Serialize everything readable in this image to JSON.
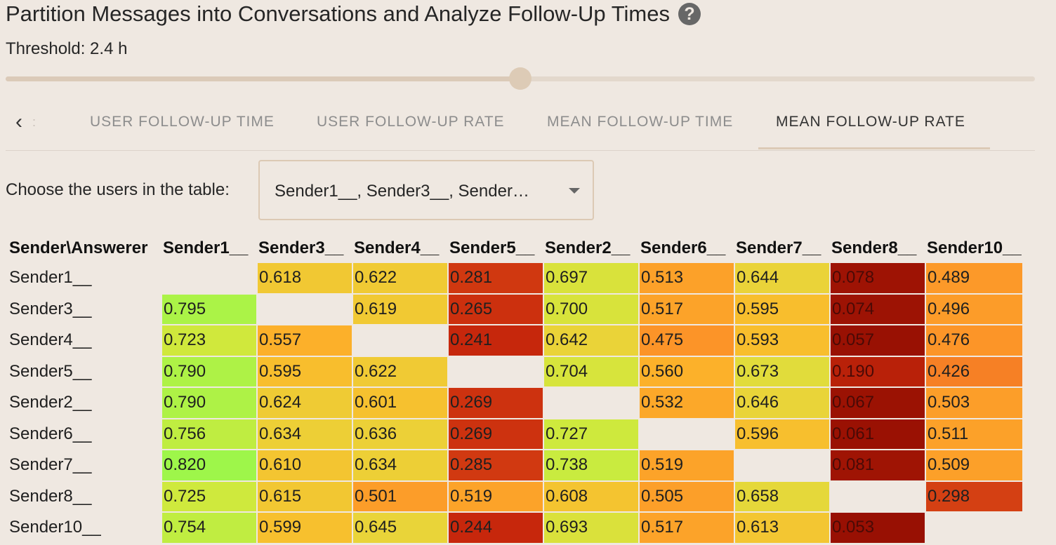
{
  "header": {
    "title": "Partition Messages into Conversations and Analyze Follow-Up Times",
    "help_icon": "?",
    "threshold_label": "Threshold: 2.4 h"
  },
  "slider": {
    "value_fraction": 0.5
  },
  "tabs": {
    "scroll_left": "‹",
    "items": [
      {
        "label": "USER FOLLOW-UP TIME",
        "active": false
      },
      {
        "label": "USER FOLLOW-UP RATE",
        "active": false
      },
      {
        "label": "MEAN FOLLOW-UP TIME",
        "active": false
      },
      {
        "label": "MEAN FOLLOW-UP RATE",
        "active": true
      }
    ]
  },
  "filter": {
    "label": "Choose the users in the table:",
    "selected_display": "Sender1__, Sender3__, Sender…"
  },
  "table": {
    "corner_header": "Sender\\Answerer",
    "columns": [
      "Sender1__",
      "Sender3__",
      "Sender4__",
      "Sender5__",
      "Sender2__",
      "Sender6__",
      "Sender7__",
      "Sender8__",
      "Sender10__"
    ],
    "rows": [
      {
        "label": "Sender1__",
        "values": [
          "",
          "0.618",
          "0.622",
          "0.281",
          "0.697",
          "0.513",
          "0.644",
          "0.078",
          "0.489"
        ]
      },
      {
        "label": "Sender3__",
        "values": [
          "0.795",
          "",
          "0.619",
          "0.265",
          "0.700",
          "0.517",
          "0.595",
          "0.074",
          "0.496"
        ]
      },
      {
        "label": "Sender4__",
        "values": [
          "0.723",
          "0.557",
          "",
          "0.241",
          "0.642",
          "0.475",
          "0.593",
          "0.057",
          "0.476"
        ]
      },
      {
        "label": "Sender5__",
        "values": [
          "0.790",
          "0.595",
          "0.622",
          "",
          "0.704",
          "0.560",
          "0.673",
          "0.190",
          "0.426"
        ]
      },
      {
        "label": "Sender2__",
        "values": [
          "0.790",
          "0.624",
          "0.601",
          "0.269",
          "",
          "0.532",
          "0.646",
          "0.067",
          "0.503"
        ]
      },
      {
        "label": "Sender6__",
        "values": [
          "0.756",
          "0.634",
          "0.636",
          "0.269",
          "0.727",
          "",
          "0.596",
          "0.061",
          "0.511"
        ]
      },
      {
        "label": "Sender7__",
        "values": [
          "0.820",
          "0.610",
          "0.634",
          "0.285",
          "0.738",
          "0.519",
          "",
          "0.081",
          "0.509"
        ]
      },
      {
        "label": "Sender8__",
        "values": [
          "0.725",
          "0.615",
          "0.501",
          "0.519",
          "0.608",
          "0.505",
          "0.658",
          "",
          "0.298"
        ]
      },
      {
        "label": "Sender10__",
        "values": [
          "0.754",
          "0.599",
          "0.645",
          "0.244",
          "0.693",
          "0.517",
          "0.613",
          "0.053",
          ""
        ]
      }
    ]
  },
  "colors": {
    "background": "#efe8e1",
    "accent": "#dccab6",
    "scale_low": "#8b0a00",
    "scale_mid": "#f5c630",
    "scale_high": "#9ef64a"
  }
}
